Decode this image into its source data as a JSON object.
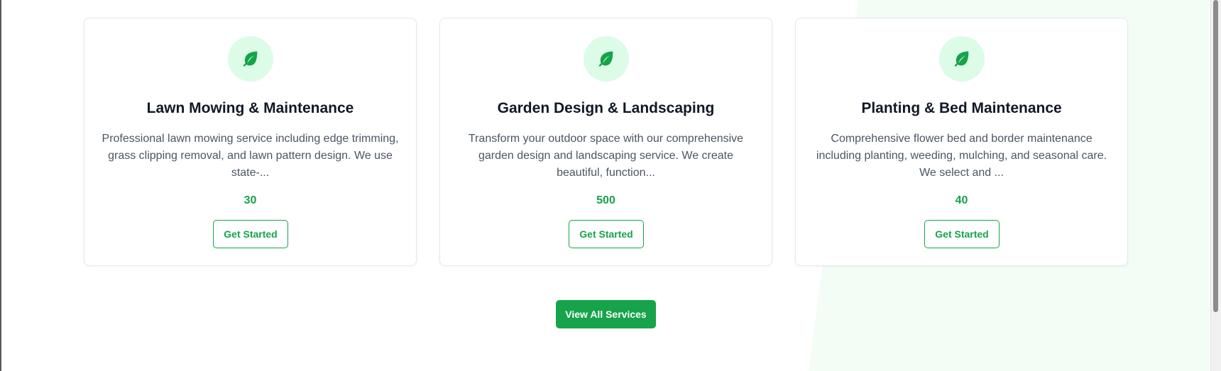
{
  "colors": {
    "accent": "#16a34a",
    "icon_bg": "#dcfce7",
    "background_shape": "#f3fcf5"
  },
  "services": [
    {
      "icon": "leaf-icon",
      "title": "Lawn Mowing & Maintenance",
      "description": "Professional lawn mowing service including edge trimming, grass clipping removal, and lawn pattern design. We use state-...",
      "price": "30",
      "button_label": "Get Started"
    },
    {
      "icon": "leaf-icon",
      "title": "Garden Design & Landscaping",
      "description": "Transform your outdoor space with our comprehensive garden design and landscaping service. We create beautiful, function...",
      "price": "500",
      "button_label": "Get Started"
    },
    {
      "icon": "leaf-icon",
      "title": "Planting & Bed Maintenance",
      "description": "Comprehensive flower bed and border maintenance including planting, weeding, mulching, and seasonal care. We select and ...",
      "price": "40",
      "button_label": "Get Started"
    }
  ],
  "view_all_label": "View All Services"
}
